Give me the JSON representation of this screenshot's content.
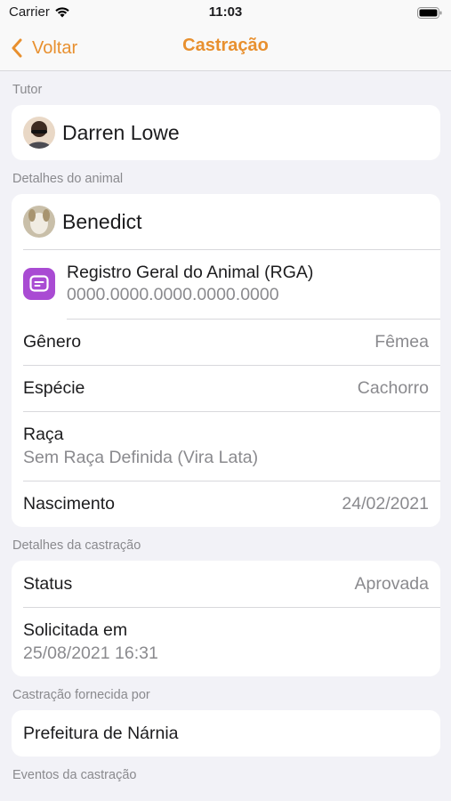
{
  "status_bar": {
    "carrier": "Carrier",
    "time": "11:03"
  },
  "nav": {
    "back_label": "Voltar",
    "title": "Castração"
  },
  "tutor": {
    "header": "Tutor",
    "name": "Darren Lowe"
  },
  "animal": {
    "header": "Detalhes do animal",
    "name": "Benedict",
    "rga_label": "Registro Geral do Animal (RGA)",
    "rga_value": "0000.0000.0000.0000.0000",
    "gender_label": "Gênero",
    "gender_value": "Fêmea",
    "species_label": "Espécie",
    "species_value": "Cachorro",
    "breed_label": "Raça",
    "breed_value": "Sem Raça Definida (Vira Lata)",
    "birth_label": "Nascimento",
    "birth_value": "24/02/2021"
  },
  "castration": {
    "header": "Detalhes da castração",
    "status_label": "Status",
    "status_value": "Aprovada",
    "requested_label": "Solicitada em",
    "requested_value": "25/08/2021 16:31"
  },
  "provider": {
    "header": "Castração fornecida por",
    "name": "Prefeitura de Nárnia"
  },
  "events": {
    "header": "Eventos da castração"
  },
  "colors": {
    "accent": "#e8902f",
    "rga_icon": "#a94bd3",
    "background": "#f2f2f7"
  },
  "icons": {
    "back": "chevron-left-icon",
    "rga": "document-icon",
    "wifi": "wifi-icon",
    "battery": "battery-icon"
  }
}
